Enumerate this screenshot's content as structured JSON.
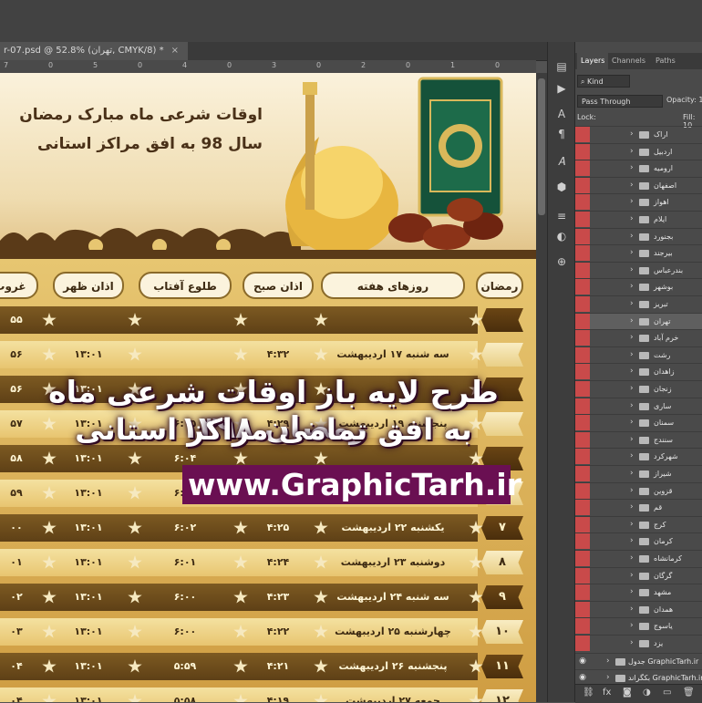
{
  "document": {
    "tab_title": "r-07.psd @ 52.8% (تهران, CMYK/8) *",
    "close_symbol": "×"
  },
  "ruler_top": [
    "7",
    "0",
    "5",
    "0",
    "4",
    "0",
    "3",
    "0",
    "2",
    "0",
    "1",
    "0"
  ],
  "banner": {
    "title_line1": "اوقات شرعی ماه مبارک رمضان",
    "title_line2": "سال 98 به افق مراکز استانی"
  },
  "table": {
    "headers": {
      "ramadan": "رمضان",
      "weekdays": "روزهای هفته",
      "fajr": "اذان صبح",
      "sunrise": "طلوع آفتاب",
      "dhuhr": "اذان ظهر",
      "maghrib": "غروب"
    },
    "rows": [
      {
        "num": "",
        "day": "",
        "fajr": "",
        "sunrise": "",
        "dhuhr": "",
        "maghrib": "۵۵"
      },
      {
        "num": "",
        "day": "سه شنبه ۱۷ اردیبهشت",
        "fajr": "۴:۳۲",
        "sunrise": "",
        "dhuhr": "۱۳:۰۱",
        "maghrib": "۵۶"
      },
      {
        "num": "",
        "day": "",
        "fajr": "",
        "sunrise": "",
        "dhuhr": "۱۳:۰۱",
        "maghrib": "۵۶"
      },
      {
        "num": "",
        "day": "پنجشنبه ۱۹ اردیبهشت",
        "fajr": "۴:۲۹",
        "sunrise": "۶:۰۵",
        "dhuhr": "۱۳:۰۱",
        "maghrib": "۵۷"
      },
      {
        "num": "",
        "day": "",
        "fajr": "",
        "sunrise": "۶:۰۴",
        "dhuhr": "۱۳:۰۱",
        "maghrib": "۵۸"
      },
      {
        "num": "۶",
        "day": "شنبه ۲۱ اردیبهشت",
        "fajr": "۴:۲۷",
        "sunrise": "۶:۰۳",
        "dhuhr": "۱۳:۰۱",
        "maghrib": "۵۹"
      },
      {
        "num": "۷",
        "day": "یکشنبه ۲۲ اردیبهشت",
        "fajr": "۴:۲۵",
        "sunrise": "۶:۰۲",
        "dhuhr": "۱۳:۰۱",
        "maghrib": "۰۰"
      },
      {
        "num": "۸",
        "day": "دوشنبه ۲۳ اردیبهشت",
        "fajr": "۴:۲۴",
        "sunrise": "۶:۰۱",
        "dhuhr": "۱۳:۰۱",
        "maghrib": "۰۱"
      },
      {
        "num": "۹",
        "day": "سه شنبه ۲۴ اردیبهشت",
        "fajr": "۴:۲۳",
        "sunrise": "۶:۰۰",
        "dhuhr": "۱۳:۰۱",
        "maghrib": "۰۲"
      },
      {
        "num": "۱۰",
        "day": "چهارشنبه ۲۵ اردیبهشت",
        "fajr": "۴:۲۲",
        "sunrise": "۶:۰۰",
        "dhuhr": "۱۳:۰۱",
        "maghrib": "۰۳"
      },
      {
        "num": "۱۱",
        "day": "پنجشنبه ۲۶ اردیبهشت",
        "fajr": "۴:۲۱",
        "sunrise": "۵:۵۹",
        "dhuhr": "۱۳:۰۱",
        "maghrib": "۰۴"
      },
      {
        "num": "۱۲",
        "day": "جمعه ۲۷ اردیبهشت",
        "fajr": "۴:۱۹",
        "sunrise": "۵:۵۸",
        "dhuhr": "۱۳:۰۱",
        "maghrib": "۰۴"
      }
    ]
  },
  "promo": {
    "line1": "طرح لایه باز اوقات شرعی ماه رمضان ۱۳۹۸",
    "line2": "به افق تمامی مراکز استانی",
    "url": "www.GraphicTarh.ir"
  },
  "panel": {
    "tabs": {
      "layers": "Layers",
      "channels": "Channels",
      "paths": "Paths"
    },
    "kind": "Kind",
    "blend_mode": "Pass Through",
    "opacity_label": "Opacity: 10",
    "lock_label": "Lock:",
    "fill_label": "Fill: 10",
    "layers": [
      "اراک",
      "اردبیل",
      "ارومیه",
      "اصفهان",
      "اهواز",
      "ایلام",
      "بجنورد",
      "بیرجند",
      "بندرعباس",
      "بوشهر",
      "تبریز",
      "تهران",
      "خرم آباد",
      "رشت",
      "زاهدان",
      "زنجان",
      "ساری",
      "سمنان",
      "سنندج",
      "شهرکرد",
      "شیراز",
      "قزوین",
      "قم",
      "کرج",
      "کرمان",
      "کرمانشاه",
      "گرگان",
      "مشهد",
      "همدان",
      "یاسوج",
      "یزد"
    ],
    "bottom_layers": [
      "GraphicTarh.ir جدول",
      "GraphicTarh.ir بکگراند"
    ]
  },
  "colors": {
    "accent_magenta": "#6a0f52",
    "gold": "#c99c3a",
    "dark_brown": "#5e4016",
    "layer_visibility_red": "#c94a4a"
  }
}
